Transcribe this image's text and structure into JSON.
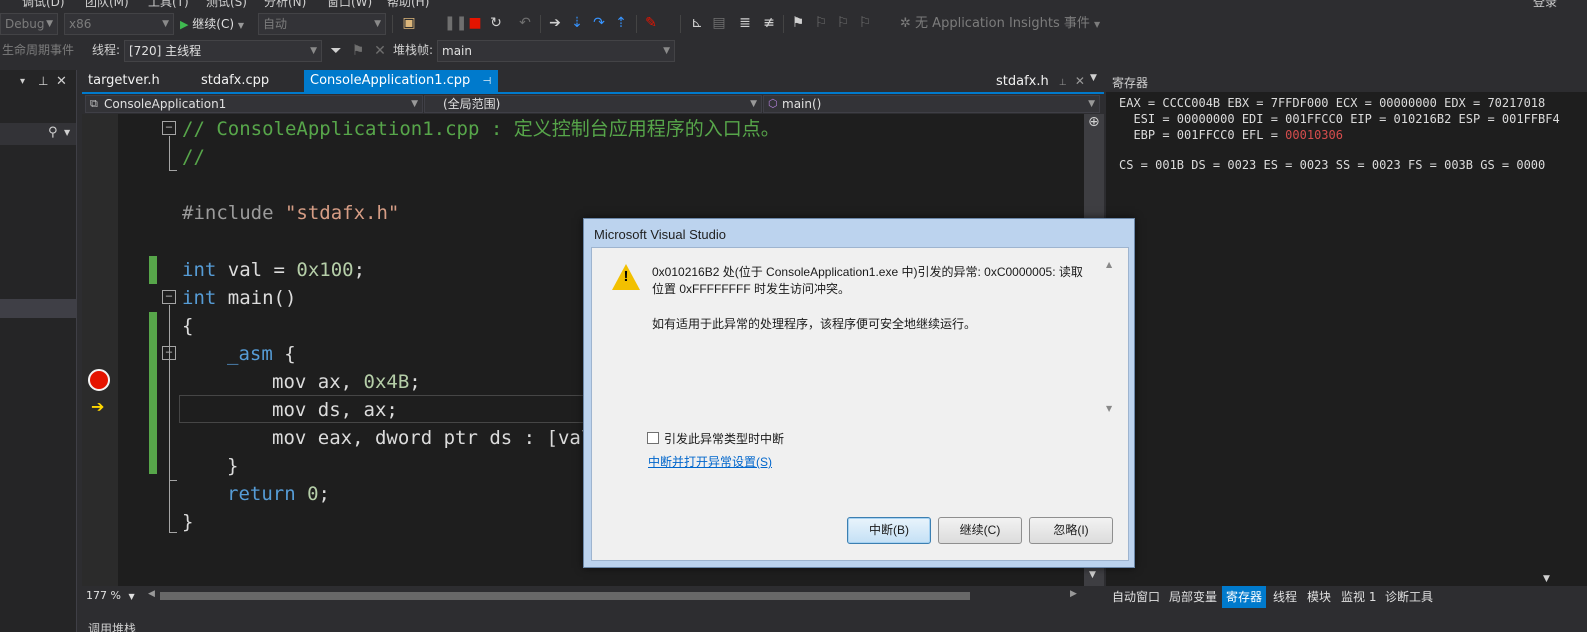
{
  "menu": {
    "items": [
      "调试(D)",
      "团队(M)",
      "工具(T)",
      "测试(S)",
      "分析(N)",
      "窗口(W)",
      "帮助(H)"
    ],
    "signin": "登录"
  },
  "toolbar": {
    "config": "Debug",
    "platform": "x86",
    "continue_label": "继续(C)",
    "auto_label": "自动",
    "insights_label": "无 Application Insights 事件"
  },
  "debug_location": {
    "lifecycle_label": "生命周期事件",
    "thread_label": "线程:",
    "thread_value": "[720] 主线程",
    "stackframe_label": "堆栈帧:",
    "stackframe_value": "main"
  },
  "tabs": [
    {
      "label": "targetver.h"
    },
    {
      "label": "stdafx.cpp"
    },
    {
      "label": "ConsoleApplication1.cpp"
    },
    {
      "label": "stdafx.h"
    }
  ],
  "navbar": {
    "project": "ConsoleApplication1",
    "scope": "(全局范围)",
    "member": "main()"
  },
  "code": {
    "line1": "// ConsoleApplication1.cpp : 定义控制台应用程序的入口点。",
    "line2": "//",
    "inc_kw": "#include",
    "inc_file": "\"stdafx.h\"",
    "val_kw": "int",
    "val_name": " val = ",
    "val_num": "0x100",
    "val_end": ";",
    "main_kw": "int",
    "main_rest": " main()",
    "brace_open": "{",
    "asm_kw": "_asm",
    "asm_open": " {",
    "mov1_a": "mov ax, ",
    "mov1_num": "0x4B",
    "mov1_end": ";",
    "mov2": "mov ds, ax;",
    "mov3": "mov eax, dword ptr ds : [val",
    "asm_close": "}",
    "ret_kw": "return",
    "ret_num": " 0",
    "ret_end": ";",
    "brace_close": "}"
  },
  "zoom": "177 %",
  "registers": {
    "title": "寄存器",
    "row1": "EAX = CCCC004B EBX = 7FFDF000 ECX = 00000000 EDX = 70217018",
    "row2": "  ESI = 00000000 EDI = 001FFCC0 EIP = 010216B2 ESP = 001FFBF4",
    "row3_prefix": "  EBP = 001FFCC0 EFL = ",
    "row3_changed": "00010306",
    "row4": "CS = 001B DS = 0023 ES = 0023 SS = 0023 FS = 003B GS = 0000"
  },
  "bottom_tabs": [
    "自动窗口",
    "局部变量",
    "寄存器",
    "线程",
    "模块",
    "监视 1",
    "诊断工具"
  ],
  "dialog": {
    "title": "Microsoft Visual Studio",
    "msg_line1": "0x010216B2 处(位于 ConsoleApplication1.exe 中)引发的异常: 0xC0000005: 读取",
    "msg_line2": "位置 0xFFFFFFFF 时发生访问冲突。",
    "msg_line3": "如有适用于此异常的处理程序，该程序便可安全地继续运行。",
    "checkbox_label": "引发此异常类型时中断",
    "link_label": "中断并打开异常设置(S)",
    "btn_break": "中断(B)",
    "btn_continue": "继续(C)",
    "btn_ignore": "忽略(I)"
  },
  "colors": {
    "accent": "#007acc",
    "comment": "#57a64a",
    "keyword": "#569cd6",
    "changed_register": "#d64d4d",
    "breakpoint": "#e51400"
  },
  "bottom_panel_title": "调用堆栈"
}
